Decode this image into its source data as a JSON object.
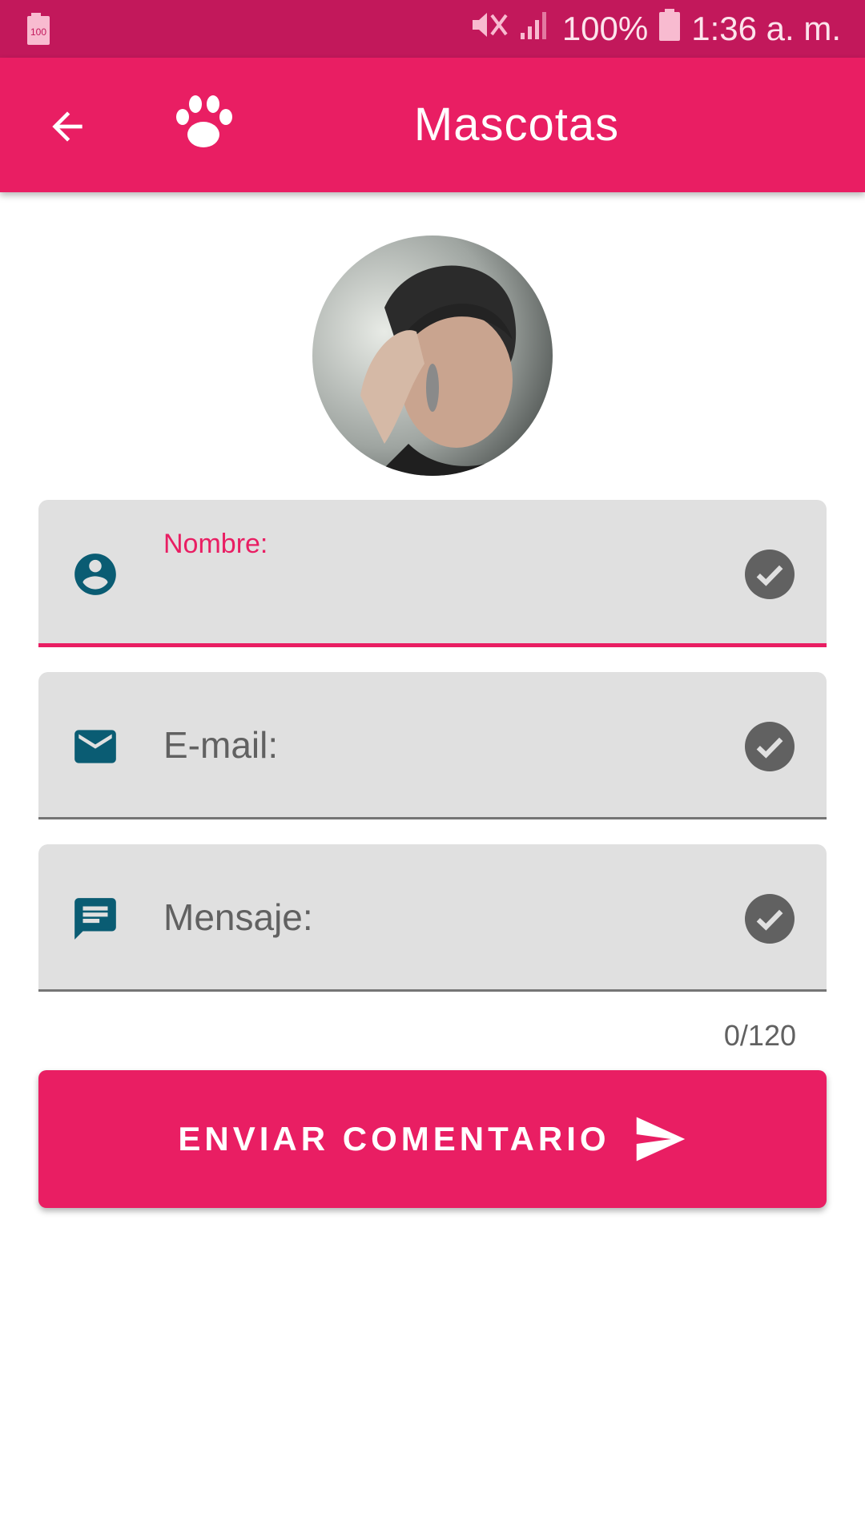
{
  "status_bar": {
    "battery_saver_text": "100",
    "battery_text": "100%",
    "time": "1:36 a. m.",
    "icons": [
      "battery-saver-icon",
      "mute-icon",
      "signal-icon",
      "battery-icon"
    ]
  },
  "app_bar": {
    "title": "Mascotas",
    "back_icon": "arrow-back-icon",
    "logo_icon": "paw-icon"
  },
  "form": {
    "name": {
      "label": "Nombre:",
      "icon": "person-icon",
      "status_icon": "check-circle-icon"
    },
    "email": {
      "label": "E-mail:",
      "icon": "mail-icon",
      "status_icon": "check-circle-icon"
    },
    "message": {
      "label": "Mensaje:",
      "icon": "message-icon",
      "status_icon": "check-circle-icon"
    },
    "counter": "0/120",
    "submit_label": "ENVIAR COMENTARIO",
    "submit_icon": "send-icon"
  },
  "colors": {
    "status_bar": "#c2185b",
    "primary": "#e91e63",
    "icon_teal": "#0a5c73",
    "field_bg": "#e0e0e0",
    "check_gray": "#616161"
  }
}
